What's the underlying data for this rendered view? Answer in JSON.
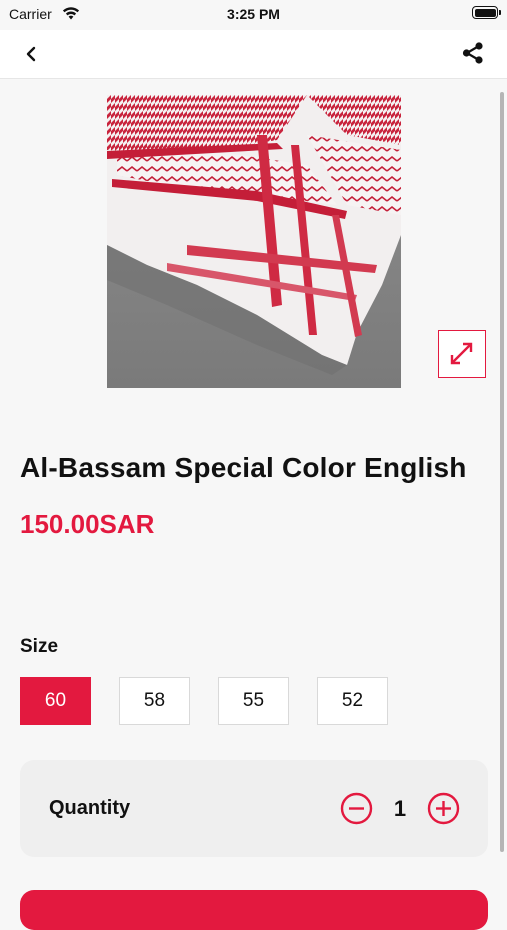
{
  "status_bar": {
    "carrier": "Carrier",
    "time": "3:25 PM"
  },
  "nav": {
    "back_icon": "chevron-left-icon",
    "share_icon": "share-icon"
  },
  "product": {
    "image_description_icon": "expand-icon",
    "title": "Al-Bassam Special Color English",
    "price": "150.00SAR"
  },
  "size": {
    "label": "Size",
    "options": [
      "60",
      "58",
      "55",
      "52"
    ],
    "selected": "60"
  },
  "quantity": {
    "label": "Quantity",
    "value": "1"
  },
  "colors": {
    "accent": "#e3193f",
    "background": "#f7f7f7"
  }
}
